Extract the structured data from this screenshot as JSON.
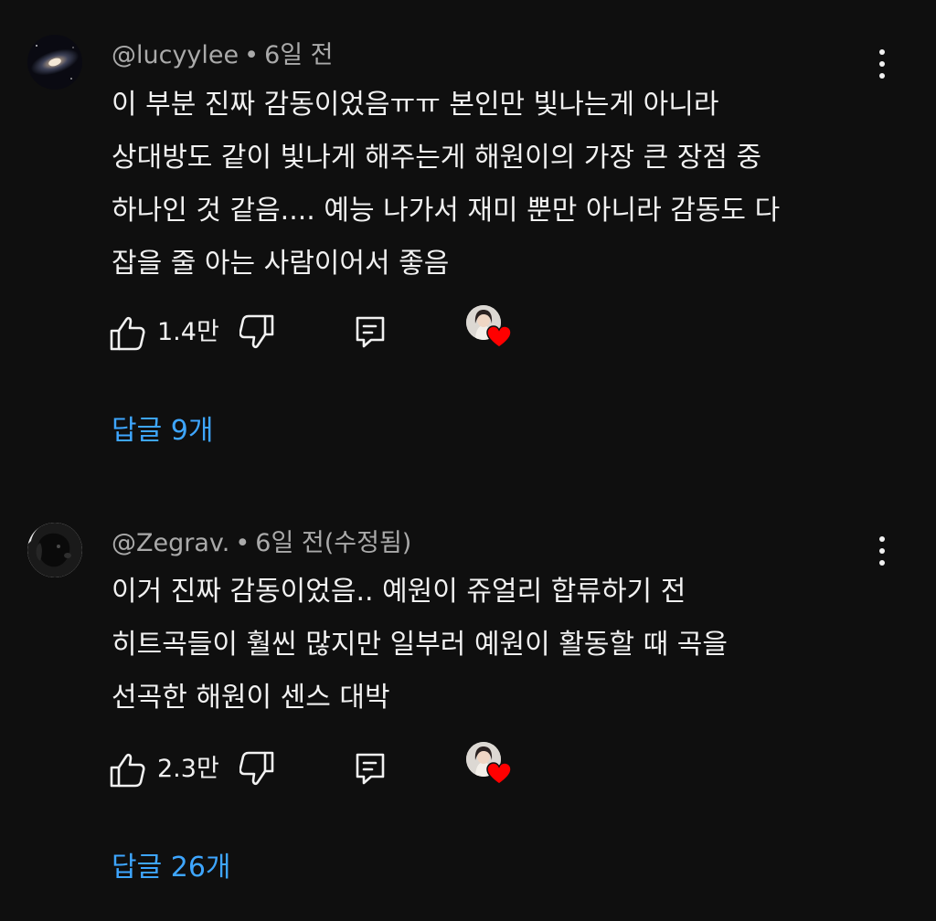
{
  "comments": [
    {
      "handle": "@lucyylee",
      "separator": "•",
      "time": "6일 전",
      "edited": "",
      "lines": [
        "이 부분 진짜 감동이었음ㅠㅠ 본인만 빛나는게 아니라",
        "상대방도 같이 빛나게 해주는게 해원이의 가장 큰 장점 중",
        "하나인 것 같음.... 예능 나가서 재미 뿐만 아니라 감동도 다",
        "잡을 줄 아는 사람이어서 좋음"
      ],
      "likes": "1.4만",
      "replies": "답글 9개",
      "avatar_icon": "galaxy-avatar"
    },
    {
      "handle": "@Zegrav.",
      "separator": "•",
      "time": "6일 전",
      "edited": "(수정됨)",
      "lines": [
        "이거 진짜 감동이었음.. 예원이 쥬얼리 합류하기 전",
        "히트곡들이 훨씬 많지만 일부러 예원이 활동할 때 곡을",
        "선곡한 해원이 센스 대박"
      ],
      "likes": "2.3만",
      "replies": "답글 26개",
      "avatar_icon": "dog-avatar"
    }
  ],
  "colors": {
    "background": "#0f0f0f",
    "text": "#f1f1f1",
    "meta": "#aaaaaa",
    "link": "#3ea6ff",
    "heart": "#ff0000"
  },
  "icons": [
    "thumbs-up-icon",
    "thumbs-down-icon",
    "reply-icon",
    "more-vert-icon",
    "heart-icon"
  ]
}
